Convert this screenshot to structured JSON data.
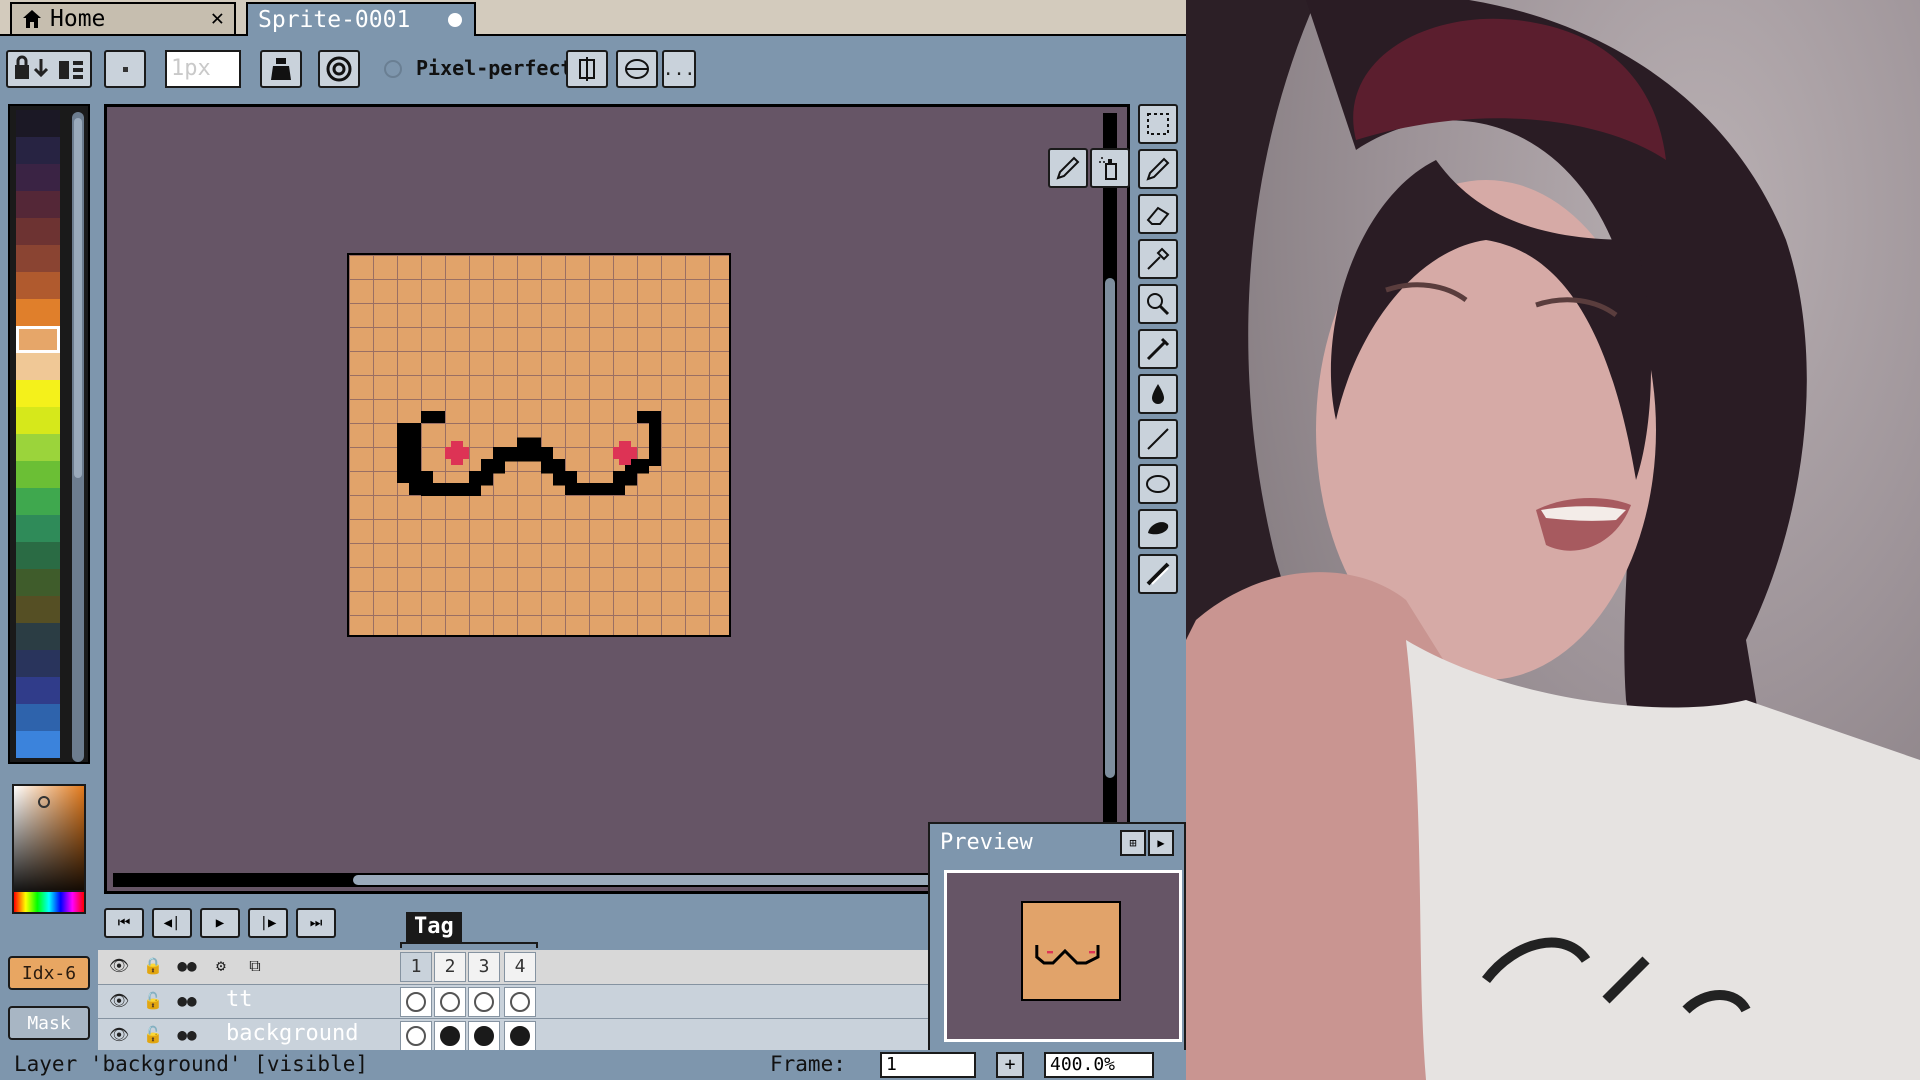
{
  "tabs": [
    {
      "label": "Home",
      "closable": true
    },
    {
      "label": "Sprite-0001",
      "modified": true
    }
  ],
  "context_bar": {
    "brush_size_placeholder": "1px",
    "pixel_perfect_label": "Pixel-perfect",
    "more_label": "..."
  },
  "palette": {
    "colors": [
      "#1b1825",
      "#272342",
      "#3a2344",
      "#542737",
      "#6d3332",
      "#8a4432",
      "#b05a2e",
      "#e07f2b",
      "#e6a669",
      "#f0c896",
      "#f4f11b",
      "#d6e81b",
      "#9bd43b",
      "#6bbf35",
      "#3fa84e",
      "#2f8b59",
      "#2a6b44",
      "#3f5c2b",
      "#554f24",
      "#2b3d44",
      "#29345c",
      "#303c8a",
      "#2e63ac",
      "#3b83dc"
    ],
    "selected_index": 8,
    "index_label": "Idx-6",
    "mask_label": "Mask"
  },
  "sprite": {
    "grid_size": 16,
    "background_color": "#e1a36a",
    "grid_color": "#9a6f63",
    "line_color": "#000000",
    "accent_color": "#dd3355"
  },
  "timeline": {
    "tag_name": "Tag",
    "frames": [
      "1",
      "2",
      "3",
      "4"
    ],
    "layers": [
      {
        "name": "tt",
        "cels": [
          false,
          false,
          false,
          false
        ]
      },
      {
        "name": "background",
        "cels": [
          false,
          true,
          true,
          true
        ]
      }
    ]
  },
  "preview": {
    "title": "Preview"
  },
  "status": {
    "text": "Layer 'background' [visible]",
    "frame_label": "Frame:",
    "frame_value": "1",
    "add_label": "+",
    "zoom_value": "400.0%"
  }
}
